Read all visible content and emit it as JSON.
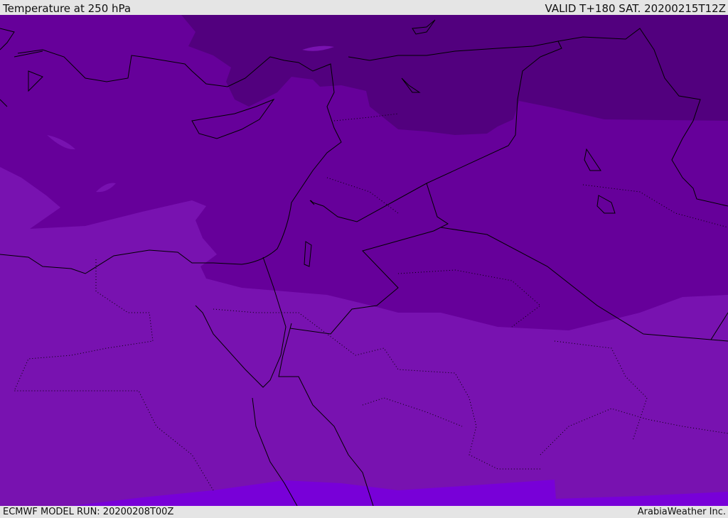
{
  "header": {
    "title": "Temperature at 250 hPa",
    "valid": "VALID T+180 SAT. 20200215T12Z"
  },
  "footer": {
    "model_run": "ECMWF MODEL RUN: 20200208T00Z",
    "credit": "ArabiaWeather Inc."
  },
  "colors": {
    "coldest": "#52007e",
    "cold": "#66009a",
    "mild": "#7812b0",
    "warmest": "#7800d8",
    "coast": "#000000"
  }
}
